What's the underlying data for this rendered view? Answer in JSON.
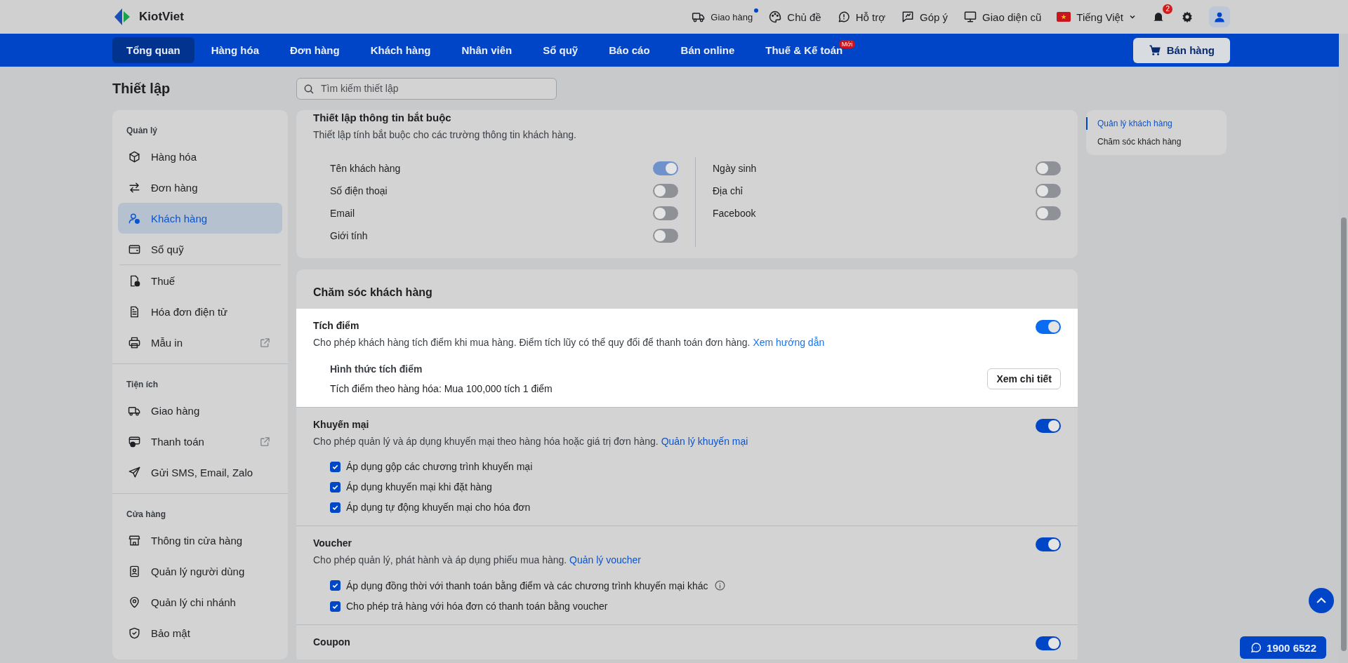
{
  "topbar": {
    "logo": "KiotViet",
    "actions": [
      {
        "label": "Giao hàng",
        "dot": true
      },
      {
        "label": "Chủ đề",
        "dot": false
      },
      {
        "label": "Hỗ trợ",
        "dot": false
      },
      {
        "label": "Góp ý",
        "dot": false
      },
      {
        "label": "Giao diện cũ",
        "dot": false
      }
    ],
    "language": "Tiếng Việt",
    "notification_count": "2"
  },
  "nav": {
    "tabs": [
      {
        "label": "Tổng quan",
        "selected": true
      },
      {
        "label": "Hàng hóa",
        "selected": false
      },
      {
        "label": "Đơn hàng",
        "selected": false
      },
      {
        "label": "Khách hàng",
        "selected": false
      },
      {
        "label": "Nhân viên",
        "selected": false
      },
      {
        "label": "Sổ quỹ",
        "selected": false
      },
      {
        "label": "Báo cáo",
        "selected": false
      },
      {
        "label": "Bán online",
        "selected": false
      },
      {
        "label": "Thuế & Kế toán",
        "selected": false,
        "badge": "Mới"
      }
    ],
    "sell_button": "Bán hàng"
  },
  "page": {
    "title": "Thiết lập",
    "search": {
      "placeholder": "Tìm kiếm thiết lập"
    }
  },
  "sidebar": {
    "groups": [
      {
        "title": "Quản lý",
        "items": [
          {
            "label": "Hàng hóa",
            "selected": false,
            "external": false
          },
          {
            "label": "Đơn hàng",
            "selected": false,
            "external": false
          },
          {
            "label": "Khách hàng",
            "selected": true,
            "external": false
          },
          {
            "label": "Sổ quỹ",
            "selected": false,
            "external": false
          },
          {
            "label": "Thuế",
            "selected": false,
            "external": false,
            "divider_before": true
          },
          {
            "label": "Hóa đơn điện tử",
            "selected": false,
            "external": false
          },
          {
            "label": "Mẫu in",
            "selected": false,
            "external": true
          }
        ]
      },
      {
        "title": "Tiện ích",
        "items": [
          {
            "label": "Giao hàng",
            "selected": false,
            "external": false
          },
          {
            "label": "Thanh toán",
            "selected": false,
            "external": true
          },
          {
            "label": "Gửi SMS, Email, Zalo",
            "selected": false,
            "external": false
          }
        ]
      },
      {
        "title": "Cửa hàng",
        "items": [
          {
            "label": "Thông tin cửa hàng",
            "selected": false,
            "external": false
          },
          {
            "label": "Quản lý người dùng",
            "selected": false,
            "external": false
          },
          {
            "label": "Quản lý chi nhánh",
            "selected": false,
            "external": false
          },
          {
            "label": "Bảo mật",
            "selected": false,
            "external": false
          }
        ]
      }
    ]
  },
  "required_card": {
    "title": "Thiết lập thông tin bắt buộc",
    "description": "Thiết lập tính bắt buộc cho các trường thông tin khách hàng.",
    "columns": [
      [
        {
          "label": "Tên khách hàng",
          "on": true,
          "disabled": true
        },
        {
          "label": "Số điện thoại",
          "on": false,
          "disabled": false
        },
        {
          "label": "Email",
          "on": false,
          "disabled": false
        },
        {
          "label": "Giới tính",
          "on": false,
          "disabled": false
        }
      ],
      [
        {
          "label": "Ngày sinh",
          "on": false,
          "disabled": false
        },
        {
          "label": "Địa chỉ",
          "on": false,
          "disabled": false
        },
        {
          "label": "Facebook",
          "on": false,
          "disabled": false
        }
      ]
    ]
  },
  "care_card": {
    "title": "Chăm sóc khách hàng",
    "sections": [
      {
        "title": "Tích điểm",
        "description": "Cho phép khách hàng tích điểm khi mua hàng. Điểm tích lũy có thể quy đổi để thanh toán đơn hàng.",
        "link": "Xem hướng dẫn",
        "on": true,
        "highlighted": true,
        "detail": {
          "title": "Hình thức tích điểm",
          "text": "Tích điểm theo hàng hóa: Mua 100,000 tích 1 điểm",
          "button": "Xem chi tiết"
        }
      },
      {
        "title": "Khuyến mại",
        "description": "Cho phép quản lý và áp dụng khuyến mại theo hàng hóa hoặc giá trị đơn hàng.",
        "link": "Quản lý khuyến mại",
        "on": true,
        "highlighted": false,
        "options": [
          {
            "label": "Áp dụng gộp các chương trình khuyến mại",
            "checked": true,
            "info": false
          },
          {
            "label": "Áp dụng khuyến mại khi đặt hàng",
            "checked": true,
            "info": false
          },
          {
            "label": "Áp dụng tự động khuyến mại cho hóa đơn",
            "checked": true,
            "info": false
          }
        ]
      },
      {
        "title": "Voucher",
        "description": "Cho phép quản lý, phát hành và áp dụng phiếu mua hàng.",
        "link": "Quản lý voucher",
        "on": true,
        "highlighted": false,
        "options": [
          {
            "label": "Áp dụng đồng thời với thanh toán bằng điểm và các chương trình khuyến mại khác",
            "checked": true,
            "info": true
          },
          {
            "label": "Cho phép trả hàng với hóa đơn có thanh toán bằng voucher",
            "checked": true,
            "info": false
          }
        ]
      },
      {
        "title": "Coupon",
        "on": true,
        "highlighted": false
      }
    ]
  },
  "toc": {
    "items": [
      {
        "label": "Quản lý khách hàng",
        "selected": true
      },
      {
        "label": "Chăm sóc khách hàng",
        "selected": false
      }
    ]
  },
  "hotline": "1900 6522"
}
